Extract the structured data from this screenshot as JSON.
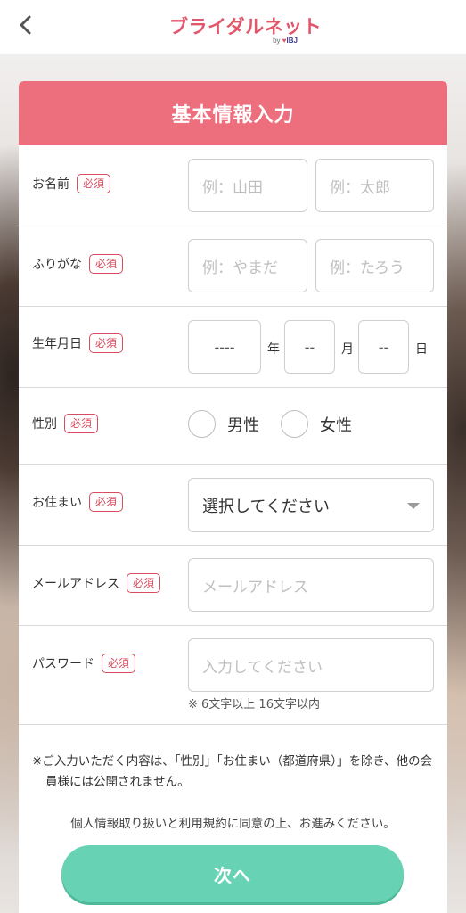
{
  "header": {
    "logo_text": "ブライダルネット",
    "logo_sub_by": "by",
    "logo_sub_brand": "IBJ"
  },
  "form": {
    "title": "基本情報入力",
    "required_badge": "必須",
    "name": {
      "label": "お名前",
      "last_placeholder": "例：山田",
      "first_placeholder": "例：太郎"
    },
    "furigana": {
      "label": "ふりがな",
      "last_placeholder": "例：やまだ",
      "first_placeholder": "例：たろう"
    },
    "birthdate": {
      "label": "生年月日",
      "year_value": "----",
      "year_unit": "年",
      "month_value": "--",
      "month_unit": "月",
      "day_value": "--",
      "day_unit": "日"
    },
    "gender": {
      "label": "性別",
      "options": [
        "男性",
        "女性"
      ]
    },
    "residence": {
      "label": "お住まい",
      "selected": "選択してください"
    },
    "email": {
      "label": "メールアドレス",
      "placeholder": "メールアドレス"
    },
    "password": {
      "label": "パスワード",
      "placeholder": "入力してください",
      "hint": "※ 6文字以上 16文字以内"
    },
    "notice": "※ご入力いただく内容は、「性別」「お住まい（都道府県）」を除き、他の会員様には公開されません。",
    "agreement": "個人情報取り扱いと利用規約に同意の上、お進みください。",
    "next_button": "次へ"
  }
}
